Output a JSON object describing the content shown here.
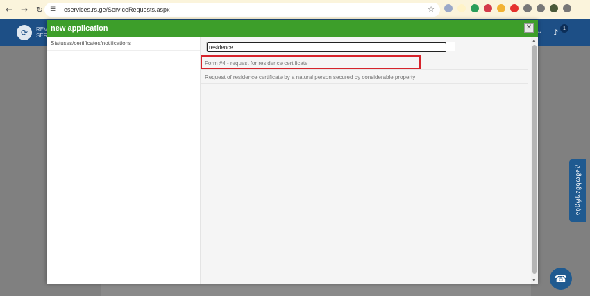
{
  "browser": {
    "url": "eservices.rs.ge/ServiceRequests.aspx",
    "back_icon": "←",
    "forward_icon": "→",
    "reload_icon": "↻",
    "site_info_icon": "☰",
    "star_icon": "☆"
  },
  "site": {
    "logo_glyph": "⟳",
    "abbr_line1": "REV",
    "abbr_line2": "SER",
    "notification_count": "1",
    "bell_icon": "♪",
    "chevron_icon": "⌄"
  },
  "modal": {
    "title": "new application",
    "close_glyph": "✕",
    "left_items": [
      "Statuses/certificates/notifications"
    ],
    "search": {
      "value": "residence",
      "placeholder": ""
    },
    "results": [
      "Form #4 - request for residence certificate",
      "Request of residence certificate by a natural person secured by considerable property"
    ]
  },
  "side_tab": {
    "label": "გამოხმაურება"
  },
  "help": {
    "glyph": "☎"
  },
  "colors": {
    "modal_header": "#3d9e2a",
    "site_header": "#1d4f86",
    "highlight": "#d6232b"
  }
}
